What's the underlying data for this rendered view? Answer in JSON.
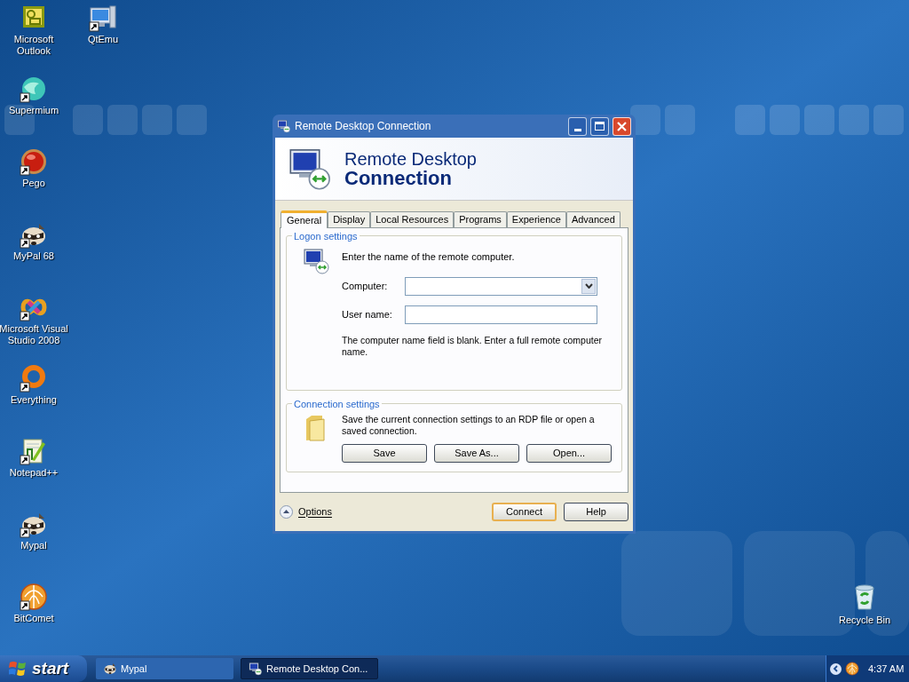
{
  "desktop_icons": [
    {
      "label": "Microsoft Outlook",
      "kind": "mail",
      "shortcut": false
    },
    {
      "label": "QtEmu",
      "kind": "monitor",
      "shortcut": true
    },
    {
      "label": "Supermium",
      "kind": "globe",
      "shortcut": true
    },
    {
      "label": "Pego",
      "kind": "ball",
      "shortcut": true
    },
    {
      "label": "MyPal 68",
      "kind": "raccoon",
      "shortcut": true
    },
    {
      "label": "Microsoft Visual Studio 2008",
      "kind": "infinity",
      "shortcut": true
    },
    {
      "label": "Everything",
      "kind": "ring",
      "shortcut": true
    },
    {
      "label": "Notepad++",
      "kind": "notepad",
      "shortcut": true
    },
    {
      "label": "Mypal",
      "kind": "raccoon",
      "shortcut": true
    },
    {
      "label": "BitComet",
      "kind": "sphere",
      "shortcut": true
    }
  ],
  "recycle_bin": {
    "label": "Recycle Bin"
  },
  "window": {
    "title": "Remote Desktop Connection",
    "banner_line_1": "Remote Desktop",
    "banner_line_2": "Connection",
    "tabs": [
      {
        "label": "General",
        "selected": true
      },
      {
        "label": "Display",
        "selected": false
      },
      {
        "label": "Local Resources",
        "selected": false
      },
      {
        "label": "Programs",
        "selected": false
      },
      {
        "label": "Experience",
        "selected": false
      },
      {
        "label": "Advanced",
        "selected": false
      }
    ],
    "logon": {
      "legend": "Logon settings",
      "intro": "Enter the name of the remote computer.",
      "computer_label": "Computer:",
      "user_label": "User name:",
      "note": "The computer name field is blank. Enter a full remote computer name."
    },
    "connection": {
      "legend": "Connection settings",
      "text": "Save the current connection settings to an RDP file or open a saved connection.",
      "buttons": [
        "Save",
        "Save As...",
        "Open..."
      ]
    },
    "options": "Options",
    "buttons": [
      {
        "label": "Connect",
        "default": true
      },
      {
        "label": "Help",
        "default": false
      }
    ]
  },
  "taskbar": {
    "start": "start",
    "items": [
      {
        "label": "Mypal",
        "kind": "raccoon",
        "selected": false
      },
      {
        "label": "Remote Desktop Con...",
        "kind": "rdp",
        "selected": true
      }
    ],
    "clock": "4:37 AM"
  }
}
